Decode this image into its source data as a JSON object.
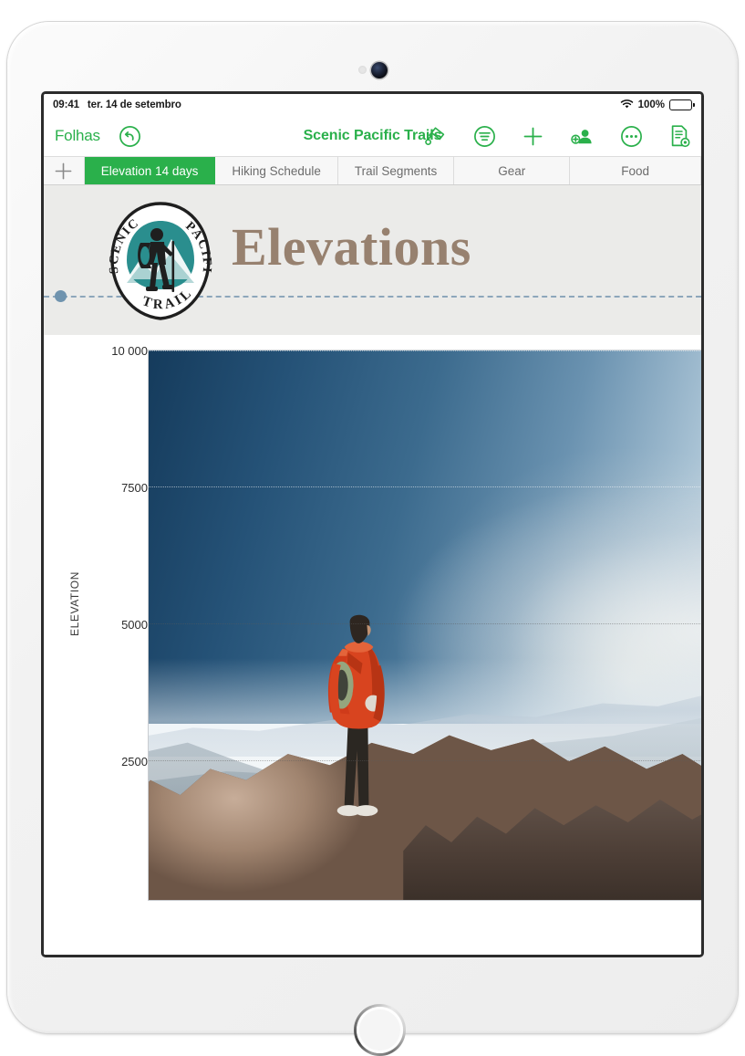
{
  "status_bar": {
    "time": "09:41",
    "date": "ter. 14 de setembro",
    "battery_percent": "100%",
    "wifi_icon": "wifi-icon",
    "battery_icon": "battery-full-icon"
  },
  "toolbar": {
    "back_label": "Folhas",
    "undo_icon": "undo-icon",
    "document_title": "Scenic Pacific Trails",
    "actions": [
      {
        "name": "format-brush-button",
        "icon": "paintbrush-icon"
      },
      {
        "name": "insert-button",
        "icon": "format-circle-icon"
      },
      {
        "name": "add-button",
        "icon": "plus-icon"
      },
      {
        "name": "collaborate-button",
        "icon": "add-person-icon"
      },
      {
        "name": "more-button",
        "icon": "ellipsis-circle-icon"
      },
      {
        "name": "document-options-button",
        "icon": "document-icon"
      }
    ]
  },
  "sheet_tabs": {
    "add_label": "+",
    "items": [
      {
        "label": "Elevation 14 days",
        "active": true
      },
      {
        "label": "Hiking Schedule",
        "active": false
      },
      {
        "label": "Trail Segments",
        "active": false
      },
      {
        "label": "Gear",
        "active": false
      },
      {
        "label": "Food",
        "active": false
      }
    ],
    "active_color": "#2ab04b"
  },
  "header": {
    "title": "Elevations",
    "title_color": "#97816f",
    "background_color": "#ebebe9",
    "logo": {
      "name": "scenic-pacific-trails-logo",
      "arc_left": "SCENIC",
      "arc_right": "PACIFIC",
      "bottom": "TRAILS",
      "badge_color": "#2a8e8e",
      "outline_color": "#1f1f1f"
    },
    "divider": {
      "style": "dashed",
      "color": "#7d9bb4",
      "handle": "selection-handle"
    }
  },
  "chart_data": {
    "type": "line",
    "title": "",
    "xlabel": "",
    "ylabel": "ELEVATION",
    "ylim": [
      0,
      10000
    ],
    "yticks": [
      "10 000",
      "7500",
      "5000",
      "2500"
    ],
    "ytick_values": [
      10000,
      7500,
      5000,
      2500
    ],
    "grid": true,
    "legend": "none",
    "background_image": "hiker-on-mountain-summit-photo",
    "categories": [],
    "values": []
  }
}
